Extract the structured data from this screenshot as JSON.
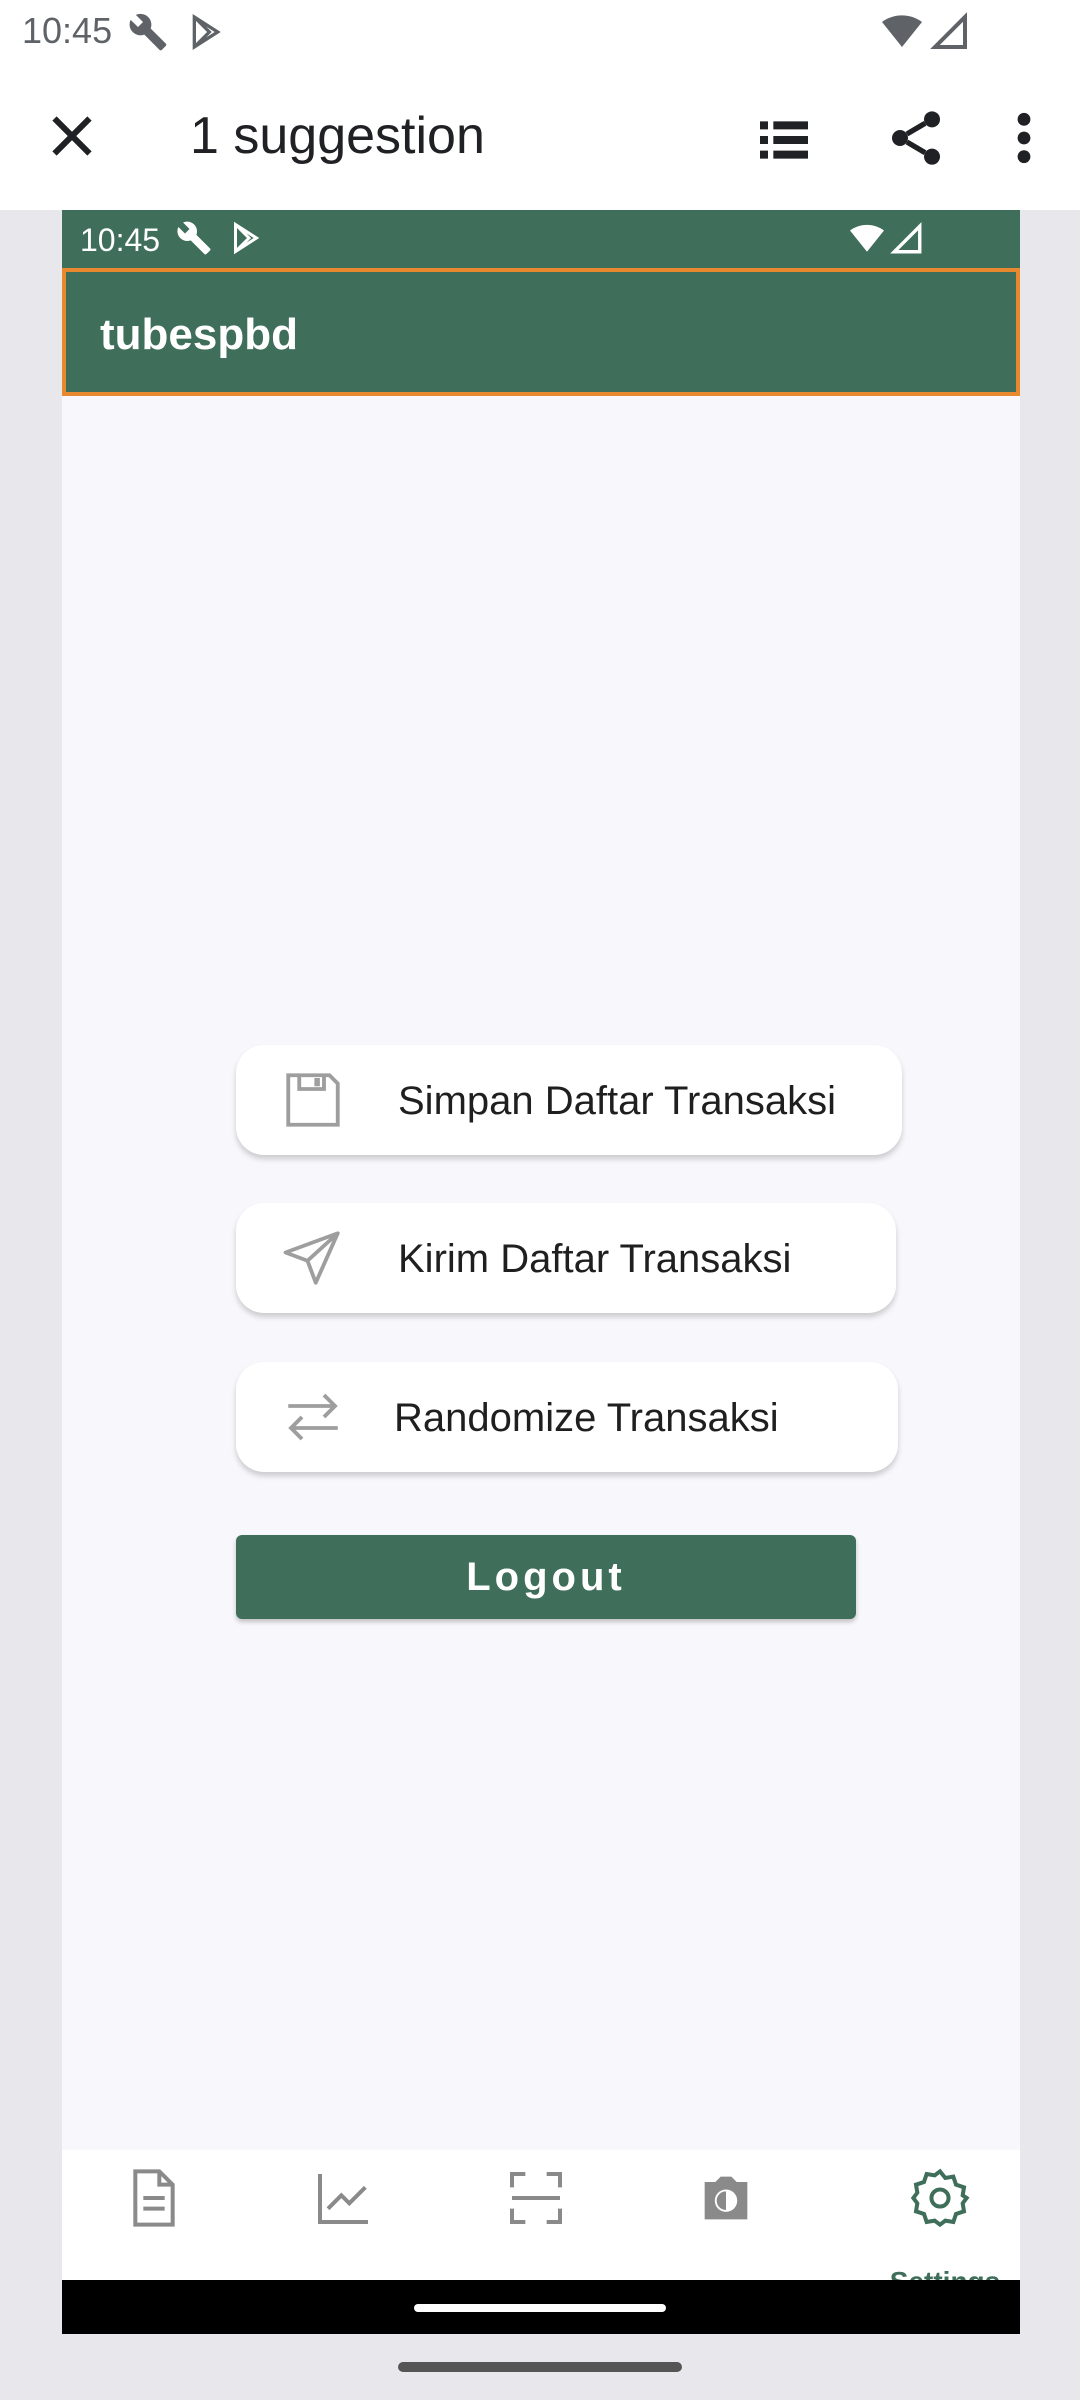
{
  "system_status": {
    "time": "10:45"
  },
  "toolbar": {
    "title": "1 suggestion"
  },
  "app": {
    "status_time": "10:45",
    "app_bar_title": "tubespbd",
    "actions": [
      {
        "label": "Simpan Daftar Transaksi",
        "icon": "save-icon"
      },
      {
        "label": "Kirim Daftar Transaksi",
        "icon": "send-icon"
      },
      {
        "label": "Randomize Transaksi",
        "icon": "swap-arrows-icon"
      }
    ],
    "logout_label": "Logout",
    "bottom_nav": [
      {
        "icon": "document-icon",
        "label": ""
      },
      {
        "icon": "chart-icon",
        "label": ""
      },
      {
        "icon": "scan-icon",
        "label": ""
      },
      {
        "icon": "camera-icon",
        "label": ""
      },
      {
        "icon": "gear-icon",
        "label": "Settings",
        "selected": true
      }
    ]
  },
  "colors": {
    "primary": "#3f6e5b",
    "highlight": "#e8892f",
    "background": "#f8f8fc"
  }
}
